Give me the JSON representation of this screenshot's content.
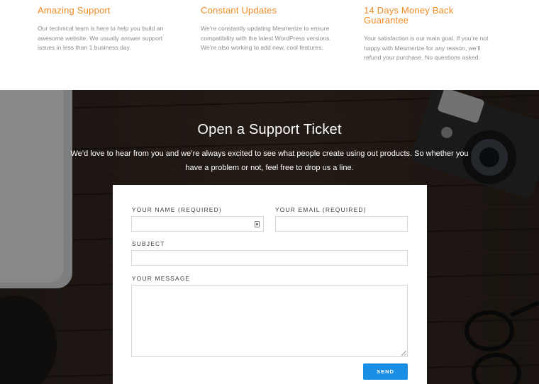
{
  "features": [
    {
      "title": "Amazing Support",
      "text": "Our technical team is here to help you build an awesome website. We usually answer support issues in less than 1 business day."
    },
    {
      "title": "Constant Updates",
      "text": "We’re constantly updating Mesmerize to ensure compatibility with the latest WordPress versions. We’re also working to add new, cool features."
    },
    {
      "title": "14 Days Money Back Guarantee",
      "text": "Your satisfaction is our main goal. If you’re not happy with Mesmerize for any reason, we’ll refund your purchase. No questions asked."
    }
  ],
  "contact": {
    "title": "Open a Support Ticket",
    "subtitle": "We’d love to hear from you and we’re always excited to see what people create using out products. So whether you have a problem or not, feel free to drop us a line.",
    "form": {
      "name_label": "YOUR NAME (REQUIRED)",
      "name_value": "",
      "email_label": "YOUR EMAIL (REQUIRED)",
      "email_value": "",
      "subject_label": "SUBJECT",
      "subject_value": "",
      "message_label": "YOUR MESSAGE",
      "message_value": "",
      "send_label": "SEND"
    }
  },
  "colors": {
    "accent_orange": "#f08a24",
    "button_blue": "#1a8fe3",
    "body_text": "#8b8b8b"
  }
}
